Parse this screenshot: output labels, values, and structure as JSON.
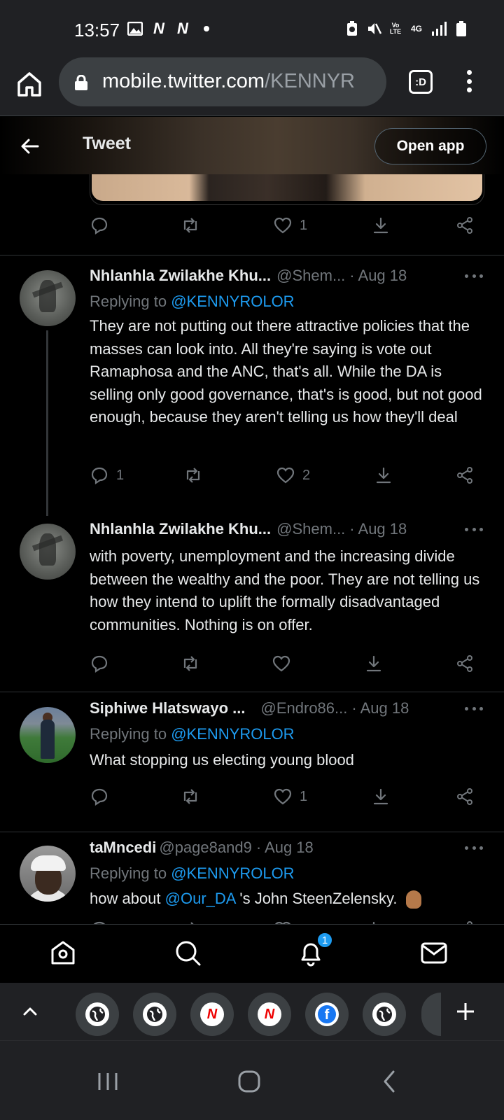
{
  "status_bar": {
    "time": "13:57",
    "left_icons": [
      "image-icon",
      "netflix-n-icon",
      "netflix-n-icon",
      "dot-icon"
    ],
    "right_icons": [
      "battery-saver-icon",
      "mute-icon",
      "volte-icon",
      "4g-icon",
      "signal-icon",
      "battery-icon"
    ],
    "volte": "Vo LTE",
    "network": "4G"
  },
  "browser": {
    "url_domain": "mobile.twitter.com",
    "url_path": "/KENNYR",
    "tab_switch_label": ":D"
  },
  "header": {
    "title": "Tweet",
    "open_app_label": "Open app"
  },
  "top_tweet_actions": {
    "reply": "",
    "retweet": "",
    "like": "1"
  },
  "tweets": [
    {
      "name": "Nhlanhla Zwilakhe Khu...",
      "handle": "@Shem...",
      "date": "· Aug 18",
      "replying_prefix": "Replying to",
      "replying_to": "@KENNYROLOR",
      "text": "They are not putting out there attractive policies that the masses can look into. All they're saying is vote out Ramaphosa and the ANC, that's all. While the DA is selling only good governance, that's is good, but not good enough, because they aren't telling us how they'll deal",
      "reply_count": "1",
      "like_count": "2"
    },
    {
      "name": "Nhlanhla Zwilakhe Khu...",
      "handle": "@Shem...",
      "date": "· Aug 18",
      "text": "with poverty, unemployment and the increasing divide between the wealthy and the poor. They are not telling us how they intend to uplift the formally disadvantaged communities. Nothing is on offer.",
      "reply_count": "",
      "like_count": ""
    },
    {
      "name": "Siphiwe Hlatswayo ...",
      "handle": "@Endro86...",
      "date": "· Aug 18",
      "replying_prefix": "Replying to",
      "replying_to": "@KENNYROLOR",
      "text": "What stopping us electing young blood",
      "reply_count": "",
      "like_count": "1"
    },
    {
      "name": "taMncedi",
      "handle": "@page8and9",
      "date": "· Aug 18",
      "replying_prefix": "Replying to",
      "replying_to": "@KENNYROLOR",
      "text_prefix": "how about",
      "text_mention": "@Our_DA",
      "text_suffix": "'s John SteenZelensky.",
      "emoji": "waving-hand-icon"
    }
  ],
  "bottom_nav": {
    "items": [
      "home-icon",
      "search-icon",
      "notifications-icon",
      "messages-icon"
    ],
    "notification_badge": "1"
  },
  "tab_strip": {
    "tabs": [
      "globe-icon",
      "globe-icon",
      "news-n-icon",
      "news-n-icon",
      "facebook-icon",
      "globe-icon"
    ],
    "fb_letter": "f"
  },
  "colors": {
    "accent": "#1d9bf0",
    "background": "#000000",
    "chrome": "#202124",
    "muted": "#71767b"
  }
}
